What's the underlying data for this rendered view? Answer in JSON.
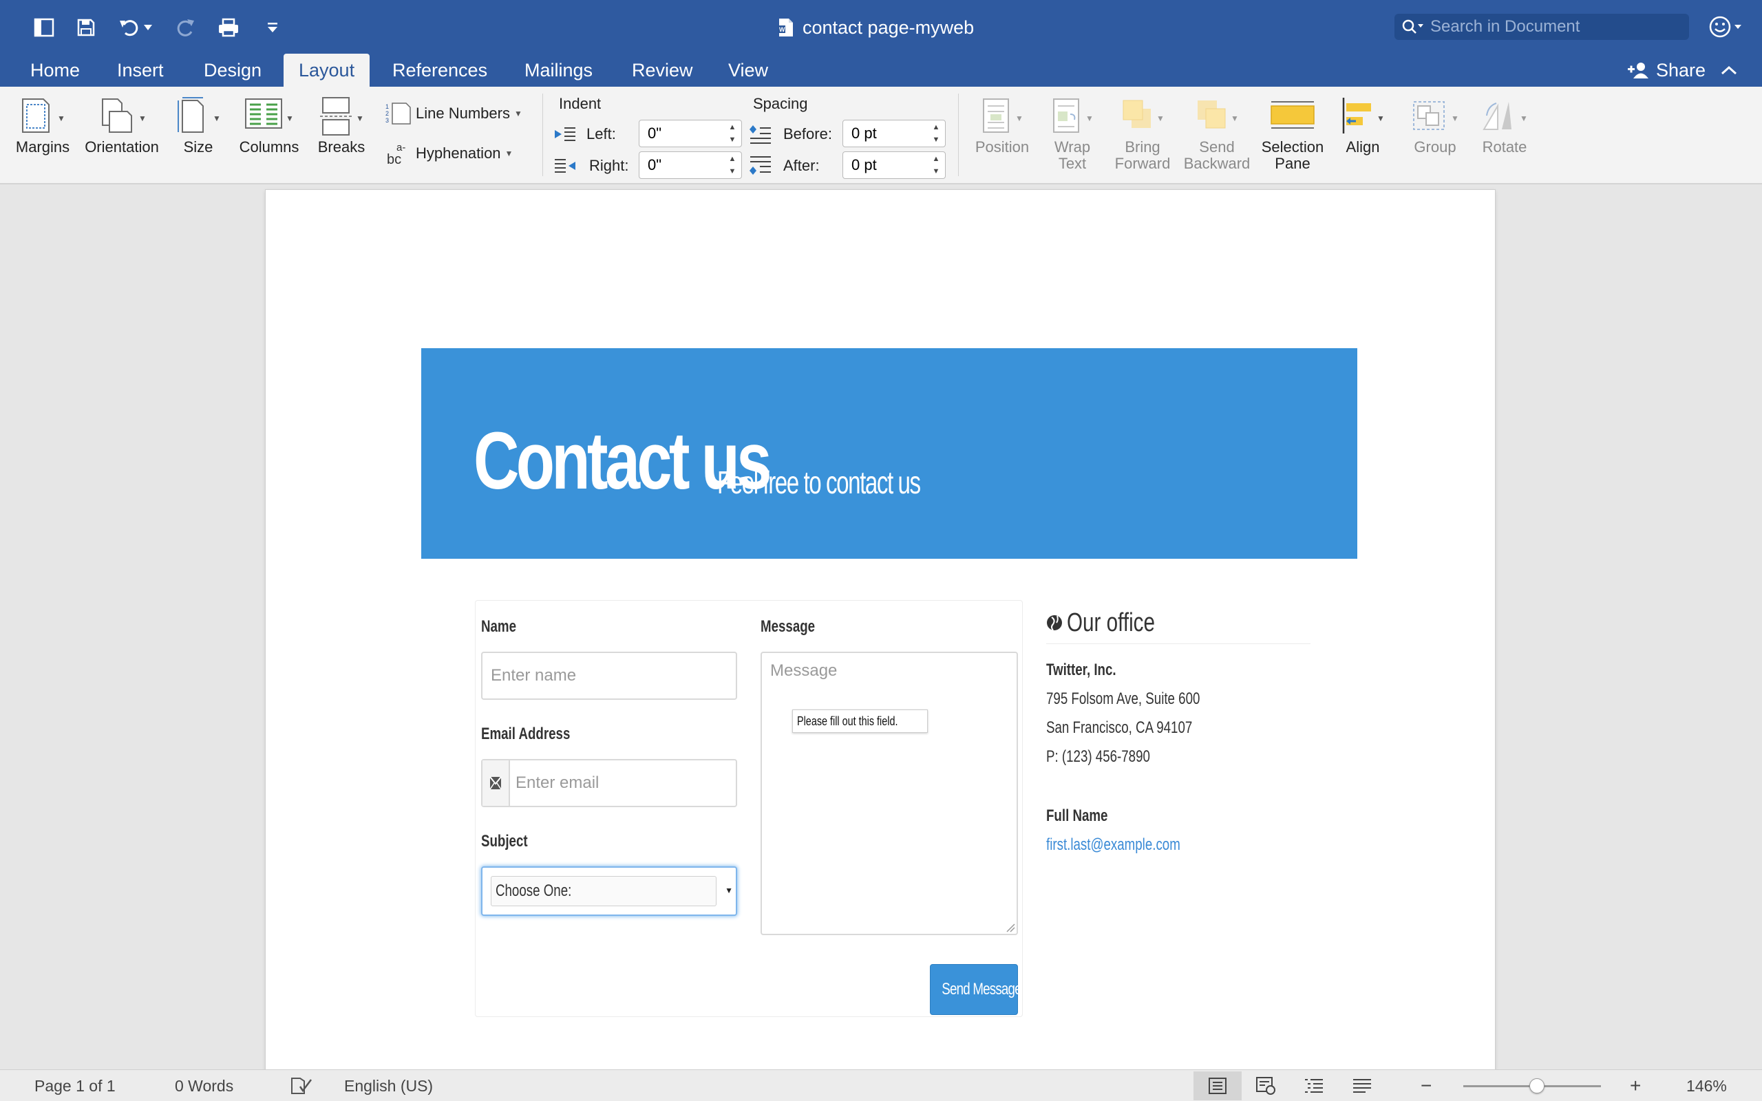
{
  "titlebar": {
    "doc_title": "contact page-myweb",
    "search_placeholder": "Search in Document"
  },
  "tabs": [
    "Home",
    "Insert",
    "Design",
    "Layout",
    "References",
    "Mailings",
    "Review",
    "View"
  ],
  "active_tab": "Layout",
  "share_label": "Share",
  "ribbon": {
    "margins": "Margins",
    "orientation": "Orientation",
    "size": "Size",
    "columns": "Columns",
    "breaks": "Breaks",
    "line_numbers": "Line Numbers",
    "hyphenation": "Hyphenation",
    "indent_title": "Indent",
    "indent_left_label": "Left:",
    "indent_left_value": "0\"",
    "indent_right_label": "Right:",
    "indent_right_value": "0\"",
    "spacing_title": "Spacing",
    "spacing_before_label": "Before:",
    "spacing_before_value": "0 pt",
    "spacing_after_label": "After:",
    "spacing_after_value": "0 pt",
    "position": "Position",
    "wrap_text_1": "Wrap",
    "wrap_text_2": "Text",
    "bring_forward_1": "Bring",
    "bring_forward_2": "Forward",
    "send_backward_1": "Send",
    "send_backward_2": "Backward",
    "selection_pane_1": "Selection",
    "selection_pane_2": "Pane",
    "align": "Align",
    "group": "Group",
    "rotate": "Rotate"
  },
  "document": {
    "hero_title": "Contact us",
    "hero_subtitle": "Feel free to contact us",
    "form": {
      "name_label": "Name",
      "name_placeholder": "Enter name",
      "email_label": "Email Address",
      "email_placeholder": "Enter email",
      "subject_label": "Subject",
      "subject_value": "Choose One:",
      "message_label": "Message",
      "message_placeholder": "Message",
      "tooltip": "Please fill out this field.",
      "send_button": "Send Message"
    },
    "office": {
      "heading": "Our office",
      "company": "Twitter, Inc.",
      "address1": "795 Folsom Ave, Suite 600",
      "address2": "San Francisco, CA 94107",
      "phone": "P: (123) 456-7890",
      "contact_name": "Full Name",
      "contact_email": "first.last@example.com"
    }
  },
  "statusbar": {
    "page": "Page 1 of 1",
    "words": "0 Words",
    "language": "English (US)",
    "zoom_out": "−",
    "zoom_in": "+",
    "zoom": "146%"
  },
  "colors": {
    "titlebar": "#2f5aa0",
    "hero": "#3a92d9",
    "link": "#3a8ad6"
  }
}
